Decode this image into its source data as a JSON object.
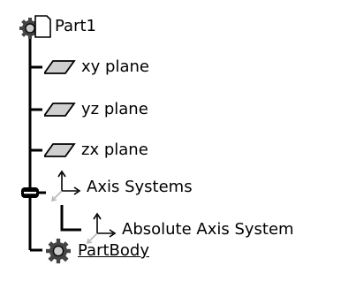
{
  "tree": {
    "root": {
      "label": "Part1",
      "icon": "part-document-icon"
    },
    "children": [
      {
        "label": "xy plane",
        "icon": "plane-icon"
      },
      {
        "label": "yz plane",
        "icon": "plane-icon"
      },
      {
        "label": "zx plane",
        "icon": "plane-icon"
      },
      {
        "label": "Axis Systems",
        "icon": "axis-system-icon",
        "expander": "expanded",
        "children": [
          {
            "label": "Absolute Axis System",
            "icon": "axis-system-icon"
          }
        ]
      },
      {
        "label": "PartBody",
        "icon": "part-body-gear-icon",
        "underlined": true
      }
    ]
  }
}
